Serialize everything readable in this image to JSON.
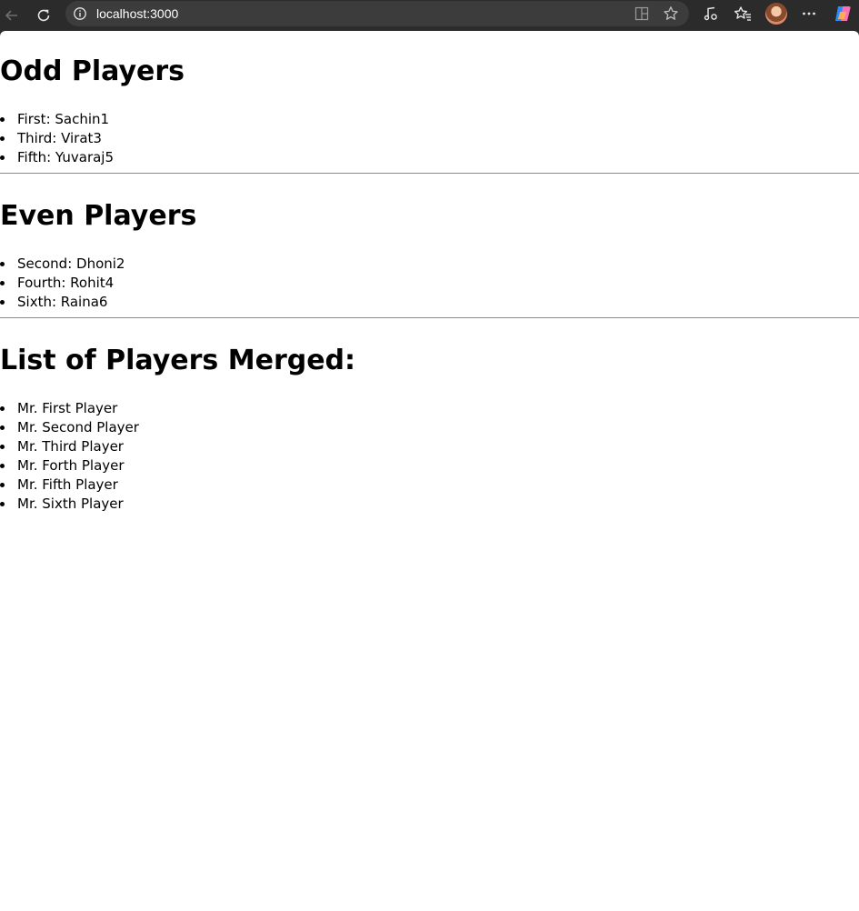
{
  "browser": {
    "url": "localhost:3000",
    "icons": [
      "back-icon",
      "refresh-icon",
      "info-icon",
      "split-screen-icon",
      "star-icon",
      "music-icon",
      "favorites-icon",
      "avatar",
      "more-icon",
      "copilot-icon"
    ]
  },
  "page": {
    "odd": {
      "heading": "Odd Players",
      "items": [
        "First: Sachin1",
        "Third: Virat3",
        "Fifth: Yuvaraj5"
      ]
    },
    "even": {
      "heading": "Even Players",
      "items": [
        "Second: Dhoni2",
        "Fourth: Rohit4",
        "Sixth: Raina6"
      ]
    },
    "merged": {
      "heading": "List of Players Merged:",
      "items": [
        "Mr. First Player",
        "Mr. Second Player",
        "Mr. Third Player",
        "Mr. Forth Player",
        "Mr. Fifth Player",
        "Mr. Sixth Player"
      ]
    }
  }
}
